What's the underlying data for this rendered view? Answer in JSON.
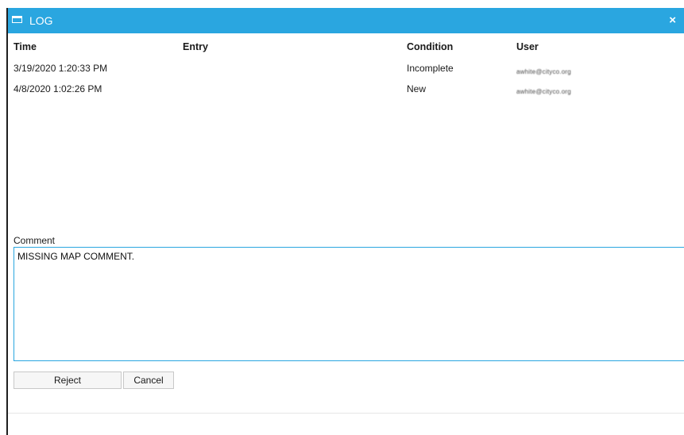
{
  "window": {
    "title": "LOG",
    "icon": "window-icon",
    "close_label": "×",
    "accent_color": "#2aa6e0"
  },
  "log_table": {
    "columns": [
      "Time",
      "Entry",
      "Condition",
      "User"
    ],
    "rows": [
      {
        "time": "3/19/2020 1:20:33 PM",
        "entry": "",
        "condition": "Incomplete",
        "user": "awhite@cityco.org"
      },
      {
        "time": "4/8/2020 1:02:26 PM",
        "entry": "",
        "condition": "New",
        "user": "awhite@cityco.org"
      }
    ]
  },
  "comment": {
    "label": "Comment",
    "value": "MISSING MAP COMMENT."
  },
  "buttons": {
    "reject_label": "Reject",
    "cancel_label": "Cancel"
  }
}
